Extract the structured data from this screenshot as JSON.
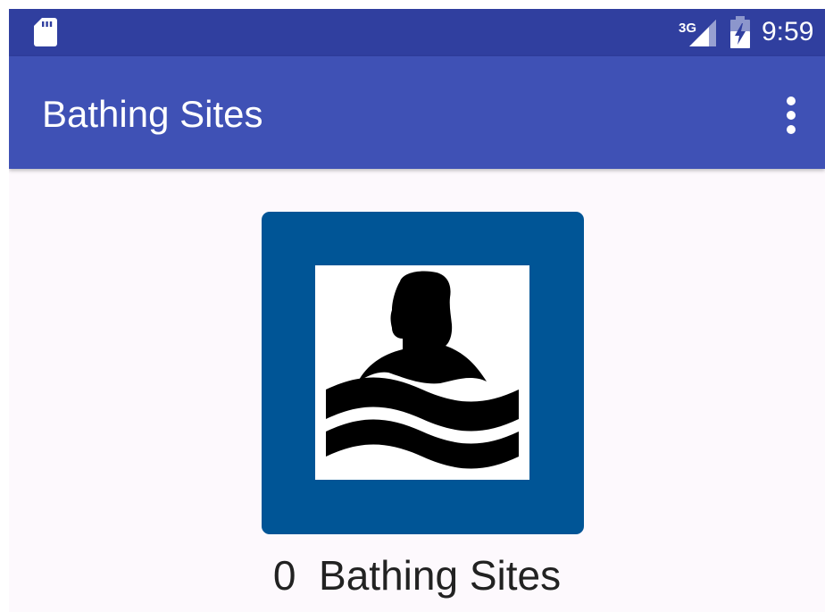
{
  "status_bar": {
    "network": "3G",
    "time": "9:59",
    "icons": [
      "sd-card-icon",
      "signal-3g-icon",
      "battery-charging-icon"
    ]
  },
  "app_bar": {
    "title": "Bathing Sites",
    "overflow_icon": "more-vert-icon"
  },
  "main": {
    "sign_icon": "swimmer-bathing-icon",
    "count": "0",
    "count_label": "Bathing Sites"
  },
  "colors": {
    "status_bar": "#303f9f",
    "app_bar": "#3f51b5",
    "sign_blue": "#005596",
    "background": "#fdf9fd"
  }
}
